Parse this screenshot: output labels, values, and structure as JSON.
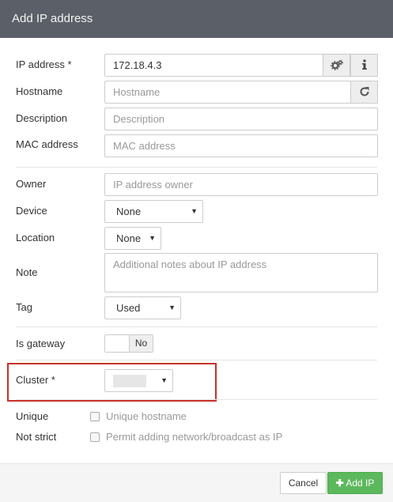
{
  "dialog": {
    "title": "Add IP address"
  },
  "fields": {
    "ip": {
      "label": "IP address *",
      "value": "172.18.4.3"
    },
    "hostname": {
      "label": "Hostname",
      "placeholder": "Hostname"
    },
    "description": {
      "label": "Description",
      "placeholder": "Description"
    },
    "mac": {
      "label": "MAC address",
      "placeholder": "MAC address"
    },
    "owner": {
      "label": "Owner",
      "placeholder": "IP address owner"
    },
    "device": {
      "label": "Device",
      "selected": "None"
    },
    "location": {
      "label": "Location",
      "selected": "None"
    },
    "note": {
      "label": "Note",
      "placeholder": "Additional notes about IP address"
    },
    "tag": {
      "label": "Tag",
      "selected": "Used"
    },
    "is_gateway": {
      "label": "Is gateway",
      "state": "No"
    },
    "cluster": {
      "label": "Cluster *"
    },
    "unique": {
      "label": "Unique",
      "option": "Unique hostname"
    },
    "not_strict": {
      "label": "Not strict",
      "option": "Permit adding network/broadcast as IP"
    }
  },
  "footer": {
    "cancel": "Cancel",
    "add": "Add IP"
  },
  "colors": {
    "header": "#5b6068",
    "success": "#5cb85c",
    "highlight": "#c9302c"
  },
  "icons": [
    "gears-icon",
    "info-icon",
    "refresh-icon",
    "plus-icon",
    "caret-down-icon"
  ]
}
